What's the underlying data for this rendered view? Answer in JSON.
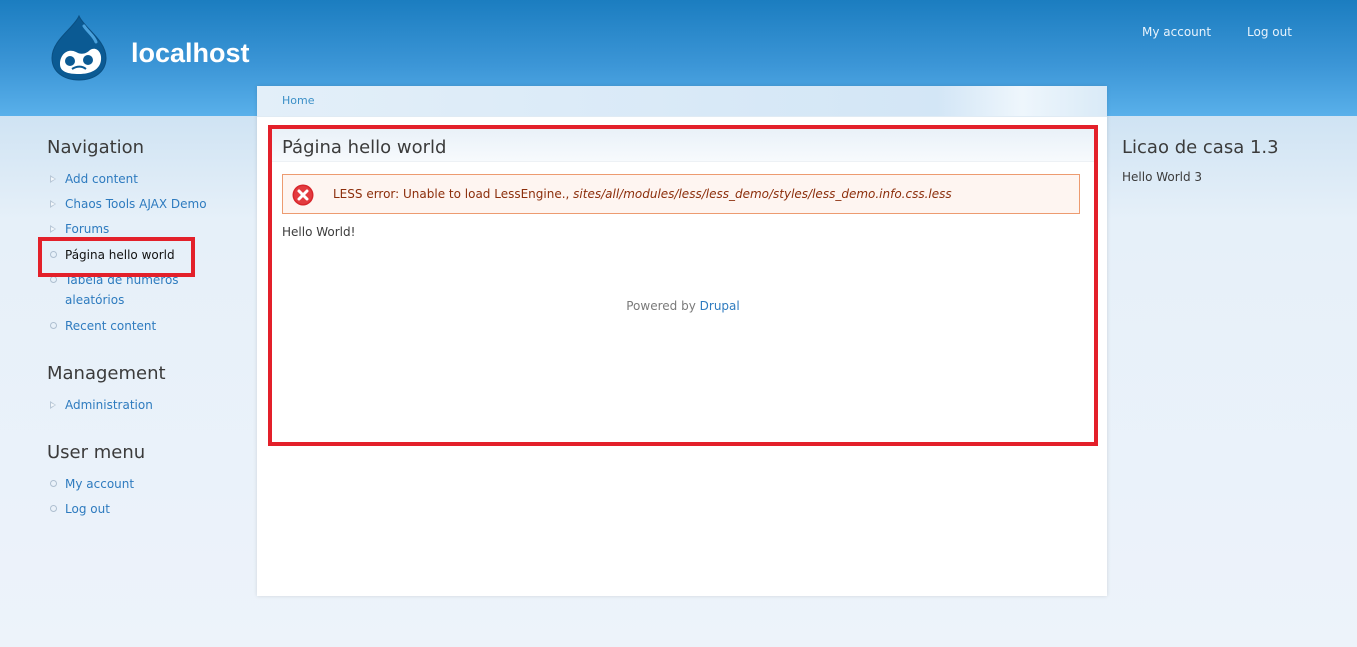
{
  "header": {
    "site_name": "localhost",
    "secondary_menu": [
      "My account",
      "Log out"
    ]
  },
  "breadcrumb": [
    "Home"
  ],
  "main": {
    "title": "Página hello world",
    "error": {
      "prefix": "LESS error: Unable to load LessEngine.,",
      "path": "sites/all/modules/less/less_demo/styles/less_demo.info.css.less"
    },
    "body_text": "Hello World!",
    "footer": {
      "prefix": "Powered by",
      "link": "Drupal"
    }
  },
  "sidebar_first": {
    "navigation": {
      "title": "Navigation",
      "items": [
        {
          "label": "Add content",
          "bullet": "collapsed",
          "active": false
        },
        {
          "label": "Chaos Tools AJAX Demo",
          "bullet": "collapsed",
          "active": false
        },
        {
          "label": "Forums",
          "bullet": "collapsed",
          "active": false
        },
        {
          "label": "Página hello world",
          "bullet": "leaf",
          "active": true
        },
        {
          "label": "Tabela de números aleatórios",
          "bullet": "leaf",
          "active": false
        },
        {
          "label": "Recent content",
          "bullet": "leaf",
          "active": false
        }
      ]
    },
    "management": {
      "title": "Management",
      "items": [
        {
          "label": "Administration",
          "bullet": "collapsed",
          "active": false
        }
      ]
    },
    "user_menu": {
      "title": "User menu",
      "items": [
        {
          "label": "My account",
          "bullet": "leaf",
          "active": false
        },
        {
          "label": "Log out",
          "bullet": "leaf",
          "active": false
        }
      ]
    }
  },
  "sidebar_second": {
    "title": "Licao de casa 1.3",
    "text": "Hello World 3"
  },
  "colors": {
    "header_blue": "#1b7dc0",
    "link_blue": "#2e7bbf",
    "highlight_red": "#e3202a",
    "error_text": "#8c2e0b"
  }
}
